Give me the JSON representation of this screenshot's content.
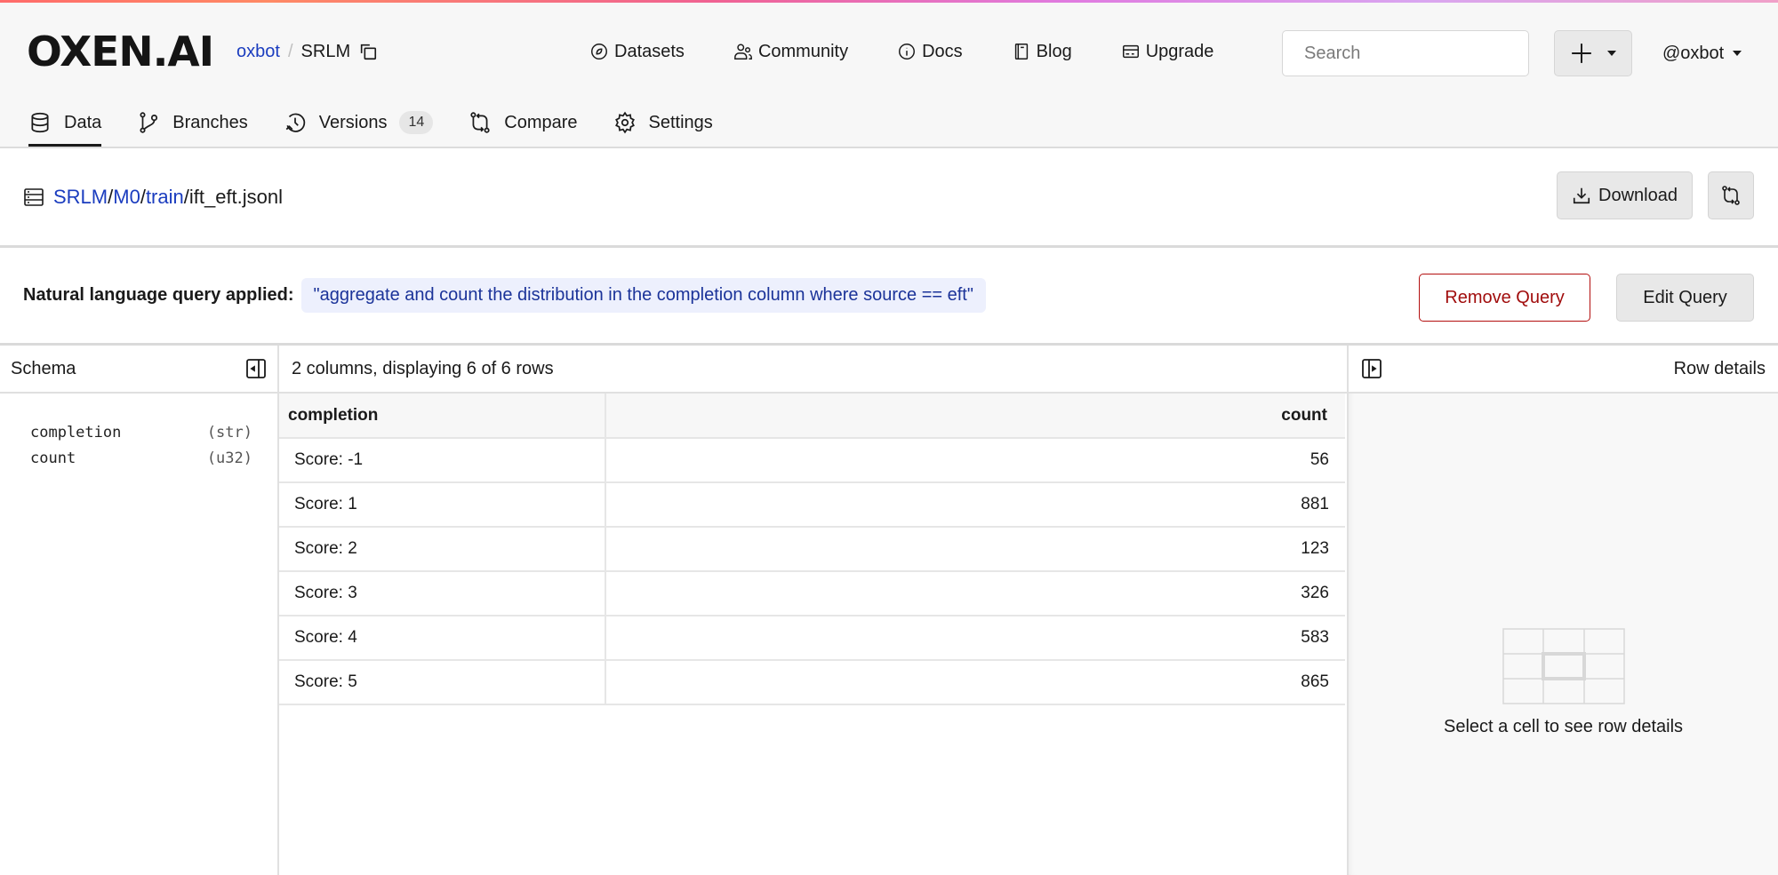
{
  "brand": {
    "logo": "OXEN.AI",
    "gradient_colors": [
      "#ff6b6b",
      "#f06292",
      "#e07be0",
      "#d9a6f0"
    ]
  },
  "repo": {
    "owner": "oxbot",
    "separator": "/",
    "name": "SRLM"
  },
  "topnav": [
    {
      "label": "Datasets",
      "icon": "compass-icon"
    },
    {
      "label": "Community",
      "icon": "users-icon"
    },
    {
      "label": "Docs",
      "icon": "info-icon"
    },
    {
      "label": "Blog",
      "icon": "book-icon"
    },
    {
      "label": "Upgrade",
      "icon": "credit-card-icon"
    }
  ],
  "search": {
    "placeholder": "Search",
    "value": ""
  },
  "user": {
    "handle": "@oxbot"
  },
  "tabs": [
    {
      "label": "Data",
      "icon": "database-icon",
      "active": true
    },
    {
      "label": "Branches",
      "icon": "branch-icon"
    },
    {
      "label": "Versions",
      "icon": "history-icon",
      "badge": "14"
    },
    {
      "label": "Compare",
      "icon": "compare-icon"
    },
    {
      "label": "Settings",
      "icon": "gear-icon"
    }
  ],
  "path": {
    "segments": [
      "SRLM",
      "M0",
      "train"
    ],
    "file": "ift_eft.jsonl"
  },
  "actions": {
    "download": "Download"
  },
  "query": {
    "label": "Natural language query applied:",
    "text": "\"aggregate and count the distribution in the completion column where source == eft\"",
    "remove": "Remove Query",
    "edit": "Edit Query",
    "accent_color": "#b30f0f"
  },
  "schema": {
    "title": "Schema",
    "fields": [
      {
        "name": "completion",
        "type": "(str)"
      },
      {
        "name": "count",
        "type": "(u32)"
      }
    ]
  },
  "table": {
    "summary": "2 columns, displaying 6 of 6 rows",
    "columns": [
      "completion",
      "count"
    ],
    "rows": [
      [
        "Score: -1",
        "56"
      ],
      [
        "Score: 1",
        "881"
      ],
      [
        "Score: 2",
        "123"
      ],
      [
        "Score: 3",
        "326"
      ],
      [
        "Score: 4",
        "583"
      ],
      [
        "Score: 5",
        "865"
      ]
    ]
  },
  "details": {
    "title": "Row details",
    "empty_message": "Select a cell to see row details"
  }
}
